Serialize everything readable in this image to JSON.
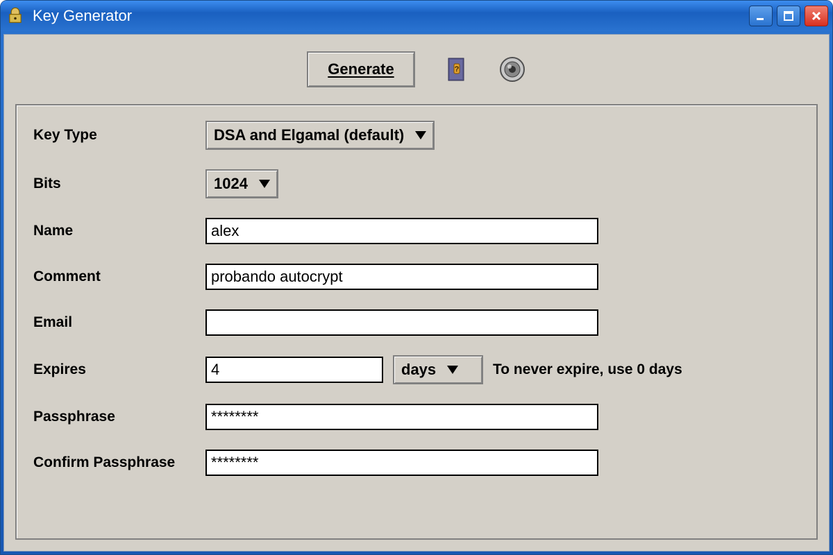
{
  "window": {
    "title": "Key Generator"
  },
  "toolbar": {
    "generate_label": "Generate"
  },
  "form": {
    "key_type": {
      "label": "Key Type",
      "value": "DSA and Elgamal (default)"
    },
    "bits": {
      "label": "Bits",
      "value": "1024"
    },
    "name": {
      "label": "Name",
      "value": "alex"
    },
    "comment": {
      "label": "Comment",
      "value": "probando autocrypt"
    },
    "email": {
      "label": "Email",
      "value": ""
    },
    "expires": {
      "label": "Expires",
      "value": "4",
      "unit": "days",
      "hint": "To never expire, use 0 days"
    },
    "passphrase": {
      "label": "Passphrase",
      "value": "********"
    },
    "confirm_passphrase": {
      "label": "Confirm Passphrase",
      "value": "********"
    }
  },
  "icons": {
    "app": "padlock-icon",
    "help": "help-book-icon",
    "disc": "disc-icon"
  }
}
